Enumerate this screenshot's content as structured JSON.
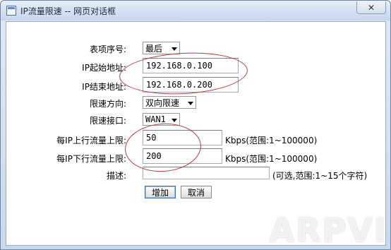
{
  "window": {
    "title": "IP流量限速 -- 网页对话框",
    "close_symbol": "✕"
  },
  "form": {
    "entry_order": {
      "label": "表项序号:",
      "value": "最后"
    },
    "ip_start": {
      "label": "IP起始地址:",
      "value": "192.168.0.100"
    },
    "ip_end": {
      "label": "IP结束地址:",
      "value": "192.168.0.200"
    },
    "direction": {
      "label": "限速方向:",
      "value": "双向限速"
    },
    "interface": {
      "label": "限速接口:",
      "value": "WAN1"
    },
    "upload_limit": {
      "label": "每IP上行流量上限:",
      "value": "50",
      "suffix": "Kbps(范围:1~100000)"
    },
    "download_limit": {
      "label": "每IP下行流量上限:",
      "value": "200",
      "suffix": "Kbps(范围:1~100000)"
    },
    "description": {
      "label": "描述:",
      "value": "",
      "suffix": "(可选,范围:1~15个字符)"
    }
  },
  "buttons": {
    "add": "增加",
    "cancel": "取消"
  },
  "watermark": "ARPVI",
  "colors": {
    "annotation": "#b73a3a",
    "title_bar": "#d3e1f1"
  }
}
